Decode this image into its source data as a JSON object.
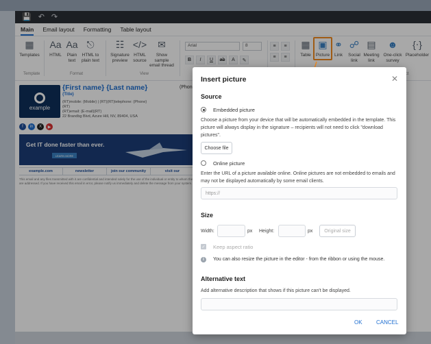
{
  "tabs": [
    "Main",
    "Email layout",
    "Formatting",
    "Table layout"
  ],
  "ribbon": {
    "templates": "Templates",
    "html": "HTML",
    "plain_text": "Plain text",
    "html_to_plain": "HTML to plain text",
    "signature_preview": "Signature preview",
    "html_source": "HTML source",
    "show_sample": "Show sample email thread",
    "font_name": "Arial",
    "font_size": "8",
    "table": "Table",
    "picture": "Picture",
    "link": "Link",
    "social_link": "Social link",
    "meeting_link": "Meeting link",
    "one_click_survey": "One-click survey",
    "placeholder": "Placeholder",
    "group_template": "Template",
    "group_format": "Format",
    "group_view": "View",
    "group_insert_tail": "ct"
  },
  "signature": {
    "name": "{First name} {Last name}",
    "title": "{Title}",
    "phone_header": "(Phone)",
    "line1": "(RT)mobile: {Mobile} | (RT)(RT)telephone: {Phone}",
    "line2": "(RT)",
    "line3": "(RT)email: {E-mail}(RT)",
    "line4": "22 Brandbg Blvd, Azure Hill, NV, 89404, USA",
    "logo_text": "example",
    "banner_title": "Get IT done faster than ever.",
    "banner_button": "LEARN MORE",
    "links": [
      "example.com",
      "newsletter",
      "join our community",
      "visit our"
    ],
    "legal": "This email and any files transmitted with it are confidential and intended solely for the use of the individual or entity to whom they are addressed. If you have received this email in error, please notify us immediately and delete the message from your system."
  },
  "dialog": {
    "title": "Insert picture",
    "source_heading": "Source",
    "embedded_label": "Embedded picture",
    "embedded_desc": "Choose a picture from your device that will be automatically embedded in the template. This picture will always display in the signature – recipients will not need to click \"download pictures\".",
    "choose_file": "Choose file",
    "online_label": "Online picture",
    "online_desc": "Enter the URL of a picture available online. Online pictures are not embedded to emails and may not be displayed automatically by some email clients.",
    "url_placeholder": "https://",
    "size_heading": "Size",
    "width_label": "Width:",
    "height_label": "Height:",
    "px": "px",
    "original_size": "Original size",
    "keep_aspect": "Keep aspect ratio",
    "resize_info": "You can also resize the picture in the editor - from the ribbon or using the mouse.",
    "alt_heading": "Alternative text",
    "alt_desc": "Add alternative description that shows if this picture can't be displayed.",
    "ok": "OK",
    "cancel": "CANCEL"
  },
  "colors": {
    "accent": "#1f6fd1",
    "highlight": "#f28b1f"
  }
}
